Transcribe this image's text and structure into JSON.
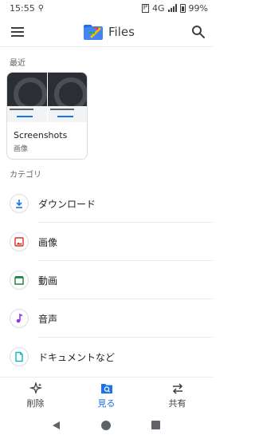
{
  "status_bar": {
    "time": "15:55",
    "network": "4G",
    "battery": "99%"
  },
  "app_bar": {
    "title": "Files"
  },
  "recent": {
    "section_label": "最近",
    "card": {
      "title": "Screenshots",
      "subtitle": "画像"
    }
  },
  "categories": {
    "section_label": "カテゴリ",
    "items": [
      {
        "label": "ダウンロード",
        "icon": "download-icon",
        "color": "#1a73e8"
      },
      {
        "label": "画像",
        "icon": "image-icon",
        "color": "#d93025"
      },
      {
        "label": "動画",
        "icon": "video-icon",
        "color": "#188038"
      },
      {
        "label": "音声",
        "icon": "audio-icon",
        "color": "#9334e6"
      },
      {
        "label": "ドキュメントなど",
        "icon": "document-icon",
        "color": "#12b5cb"
      }
    ]
  },
  "bottom_nav": {
    "items": [
      {
        "label": "削除",
        "icon": "clean-icon",
        "active": false
      },
      {
        "label": "見る",
        "icon": "browse-icon",
        "active": true
      },
      {
        "label": "共有",
        "icon": "share-icon",
        "active": false
      }
    ]
  },
  "colors": {
    "accent": "#1a73e8",
    "divider": "#e8eaed"
  }
}
